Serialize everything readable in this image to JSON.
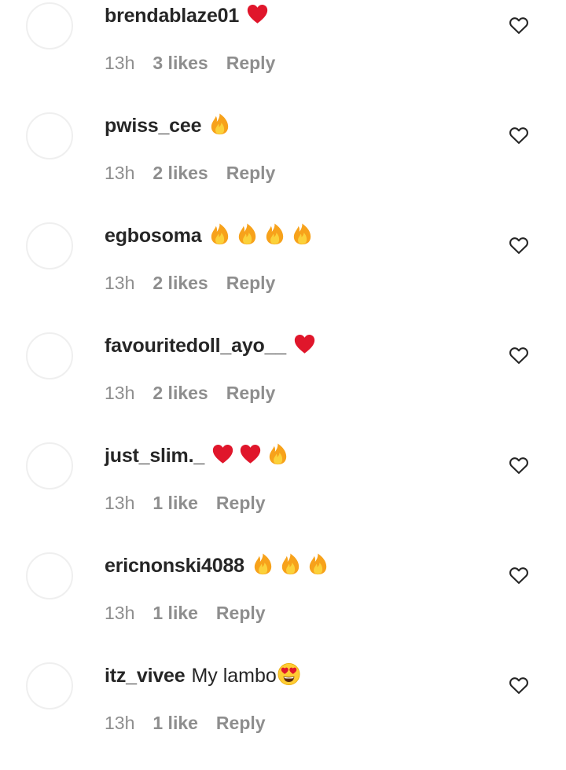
{
  "comments": [
    {
      "username": "brendablaze01",
      "text": "",
      "emojis": [
        "heart"
      ],
      "time": "13h",
      "likes": "3 likes",
      "reply": "Reply"
    },
    {
      "username": "pwiss_cee",
      "text": "",
      "emojis": [
        "fire"
      ],
      "time": "13h",
      "likes": "2 likes",
      "reply": "Reply"
    },
    {
      "username": "egbosoma",
      "text": "",
      "emojis": [
        "fire",
        "fire",
        "fire",
        "fire"
      ],
      "time": "13h",
      "likes": "2 likes",
      "reply": "Reply"
    },
    {
      "username": "favouritedoll_ayo__",
      "text": "",
      "emojis": [
        "heart"
      ],
      "time": "13h",
      "likes": "2 likes",
      "reply": "Reply"
    },
    {
      "username": "just_slim._",
      "text": "",
      "emojis": [
        "heart",
        "heart",
        "fire"
      ],
      "time": "13h",
      "likes": "1 like",
      "reply": "Reply"
    },
    {
      "username": "ericnonski4088",
      "text": "",
      "emojis": [
        "fire",
        "fire",
        "fire"
      ],
      "time": "13h",
      "likes": "1 like",
      "reply": "Reply"
    },
    {
      "username": "itz_vivee",
      "text": "My lambo",
      "emojis": [
        "heart-eyes"
      ],
      "time": "13h",
      "likes": "1 like",
      "reply": "Reply"
    }
  ],
  "colors": {
    "username": "#262626",
    "meta": "#8e8e8e",
    "heart_emoji": "#e0162b",
    "fire_outer": "#f7a21b",
    "fire_inner": "#fbd13a",
    "avatar_border": "#efefef"
  },
  "icons": {
    "like": "heart-outline-icon",
    "heart": "red-heart-emoji",
    "fire": "fire-emoji",
    "heart-eyes": "heart-eyes-emoji"
  }
}
